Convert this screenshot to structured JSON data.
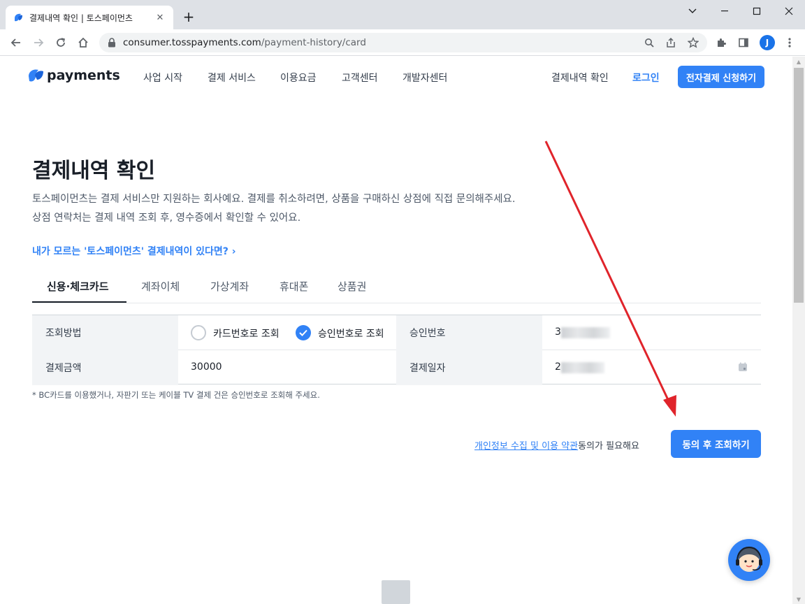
{
  "browser": {
    "tab_title": "결제내역 확인 | 토스페이먼츠",
    "url_domain": "consumer.tosspayments.com",
    "url_path": "/payment-history/card",
    "profile_initial": "J"
  },
  "gnb": {
    "logo_text": "payments",
    "menu": [
      "사업 시작",
      "결제 서비스",
      "이용요금",
      "고객센터",
      "개발자센터"
    ],
    "history": "결제내역 확인",
    "login": "로그인",
    "cta": "전자결제 신청하기"
  },
  "page": {
    "title": "결제내역 확인",
    "desc1": "토스페이먼츠는 결제 서비스만 지원하는 회사예요. 결제를 취소하려면, 상품을 구매하신 상점에 직접 문의해주세요.",
    "desc2": "상점 연락처는 결제 내역 조회 후, 영수증에서 확인할 수 있어요.",
    "help_link": "내가 모르는 '토스페이먼츠' 결제내역이 있다면?",
    "help_chevron": "›"
  },
  "payment_tabs": [
    "신용·체크카드",
    "계좌이체",
    "가상계좌",
    "휴대폰",
    "상품권"
  ],
  "form": {
    "method_label": "조회방법",
    "option_card": "카드번호로 조회",
    "option_approval": "승인번호로 조회",
    "approval_label": "승인번호",
    "approval_value_prefix": "3",
    "amount_label": "결제금액",
    "amount_value": "30000",
    "date_label": "결제일자",
    "date_value_prefix": "2"
  },
  "note": "* BC카드를 이용했거나, 자판기 또는 케이블 TV 결제 건은 승인번호로 조회해 주세요.",
  "agreement": {
    "link": "개인정보 수집 및 이용 약관",
    "suffix": "동의가 필요해요"
  },
  "submit": "동의 후 조회하기",
  "colors": {
    "accent": "#3182f6",
    "annotation_arrow": "#e0242b"
  }
}
